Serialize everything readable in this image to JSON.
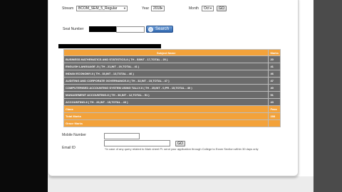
{
  "form": {
    "stream_label": "Stream",
    "stream_value": "BCOM_SEM_5_Regular",
    "year_label": "Year",
    "year_value": "2018",
    "month_label": "Month",
    "month_value": "Oct",
    "go_label": "GO",
    "seat_label": "Seat Number",
    "search_label": "Search"
  },
  "table": {
    "header_subject": "Subject Name",
    "header_marks": "Marks",
    "rows": [
      {
        "subject": "BUSINESS MATHEMATICS AND STATISTICS-II ( TH - 53INT - 17,TOTAL - 20 )",
        "marks": "20"
      },
      {
        "subject": "ENGLISH LANGUAGE -5 ( TH - 21,INT - 20,TOTAL - 41 )",
        "marks": "41"
      },
      {
        "subject": "INDIAN ECONOMY-II ( TH - 33,INT - 13,TOTAL - 46 )",
        "marks": "46"
      },
      {
        "subject": "AUDITING AND CORPORATE GOVERNANCE-II ( TH - 32,INT - 15,TOTAL - 47 )",
        "marks": "47"
      },
      {
        "subject": "COMPUTERISED ACCOUNTING SYSTEM USING TALLY-II ( TH - 25,INT - 0,PR - 15,TOTAL - 40 )",
        "marks": "40"
      },
      {
        "subject": "MANAGEMENT ACCOUNTING-II ( TH - 36,INT - 12,TOTAL - 51 )",
        "marks": "51"
      },
      {
        "subject": "ACCOUNTING-II ( TH - 26,INT - 15,TOTAL - 43 )",
        "marks": "43"
      }
    ],
    "class_label": "Class",
    "class_value": "Pass",
    "total_label": "Total Marks",
    "total_value": "288",
    "grace_label": "Grace Marks",
    "grace_value": ""
  },
  "bottom": {
    "mobile_label": "Mobile Number",
    "email_label": "Email ID",
    "go_label": "GO",
    "note": "*In case of any query related to Mark sheet Pl. send your application through College to Exam Section within 30 days only"
  },
  "colors": {
    "accent_orange": "#f3a23a",
    "row_gray": "#6b6b6b",
    "button_blue": "#2f66ae"
  }
}
